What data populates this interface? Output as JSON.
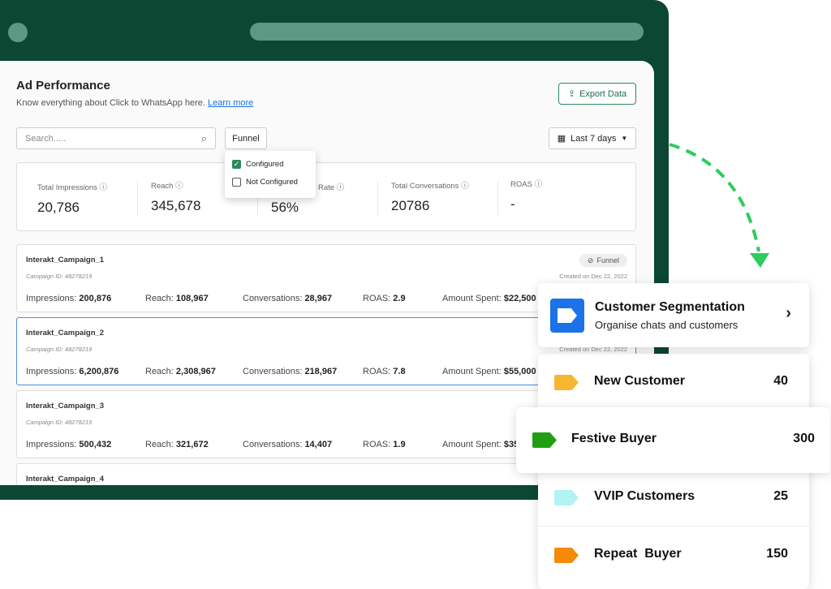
{
  "header": {
    "title": "Ad Performance",
    "subtitle": "Know everything about Click to WhatsApp here.",
    "learn_more": "Learn more",
    "export": "Export Data"
  },
  "filters": {
    "search_placeholder": "Search.....",
    "funnel": "Funnel",
    "date_range": "Last 7 days",
    "funnel_options": [
      {
        "label": "Configured",
        "checked": true
      },
      {
        "label": "Not Configured",
        "checked": false
      }
    ]
  },
  "stats": [
    {
      "label": "Total Impressions",
      "value": "20,786"
    },
    {
      "label": "Reach",
      "value": "345,678"
    },
    {
      "label": "Rate",
      "value": "56%"
    },
    {
      "label": "Total Conversations",
      "value": "20786"
    },
    {
      "label": "ROAS",
      "value": "-"
    }
  ],
  "labels": {
    "impressions": "Impressions: ",
    "reach": "Reach: ",
    "conversations": "Conversations: ",
    "roas": "ROAS: ",
    "spent": "Amount Spent: "
  },
  "campaigns": [
    {
      "name": "Interakt_Campaign_1",
      "id": "Campaign ID: 48278219",
      "badge": "Funnel",
      "created": "Created on Dec 22, 2022",
      "impressions": "200,876",
      "reach": "108,967",
      "conversations": "28,967",
      "roas": "2.9",
      "spent": "$22,500"
    },
    {
      "name": "Interakt_Campaign_2",
      "id": "Campaign ID: 48278219",
      "created": "Created on Dec 22, 2022",
      "impressions": "6,200,876",
      "reach": "2,308,967",
      "conversations": "218,967",
      "roas": "7.8",
      "spent": "$55,000"
    },
    {
      "name": "Interakt_Campaign_3",
      "id": "Campaign ID: 48278219",
      "impressions": "500,432",
      "reach": "321,672",
      "conversations": "14,407",
      "roas": "1.9",
      "spent": "$35"
    },
    {
      "name": "Interakt_Campaign_4"
    }
  ],
  "segmentation": {
    "title": "Customer Segmentation",
    "subtitle": "Organise chats and customers",
    "segments": [
      {
        "name": "New Customer",
        "count": "40",
        "color": "#f5b731"
      },
      {
        "name": "Festive Buyer",
        "count": "300",
        "color": "#1f9e12"
      },
      {
        "name": "VVIP Customers",
        "count": "25",
        "color": "#b3f3f5"
      },
      {
        "name": "Repeat  Buyer",
        "count": "150",
        "color": "#f58a07"
      }
    ]
  },
  "colors": {
    "frame": "#0b4733",
    "accent": "#2b8a5a",
    "arrow": "#2ecc5b",
    "segment_icon": "#1a73e8"
  }
}
